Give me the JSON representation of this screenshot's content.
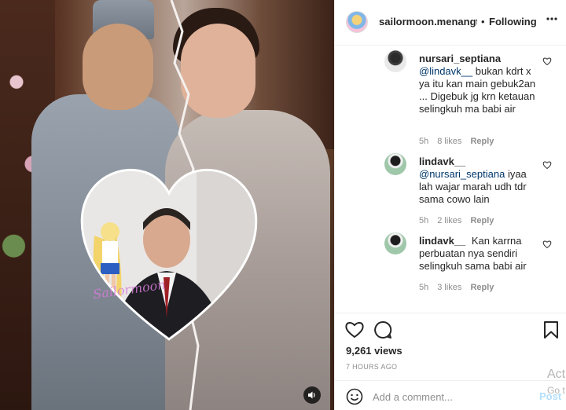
{
  "post": {
    "username": "sailormoon.menangter",
    "separator": "•",
    "follow_status": "Following",
    "watermark": "Sailormoon"
  },
  "comments": [
    {
      "user": "nursari_septiana",
      "mention": "@lindavk__",
      "text": " bukan kdrt x ya itu kan main gebuk2an ... Digebuk jg krn ketauan selingkuh ma babi air",
      "time": "5h",
      "likes": "8 likes",
      "reply": "Reply"
    },
    {
      "user": "lindavk__",
      "mention": "@nursari_septiana",
      "text": " iyaa lah wajar marah udh tdr sama cowo lain",
      "time": "5h",
      "likes": "2 likes",
      "reply": "Reply"
    },
    {
      "user": "lindavk__",
      "mention": "",
      "text": "Kan karrna perbuatan nya sendiri selingkuh sama babi air",
      "time": "5h",
      "likes": "3 likes",
      "reply": "Reply"
    }
  ],
  "stats": {
    "views": "9,261 views",
    "time_ago": "7 HOURS AGO"
  },
  "add_comment": {
    "placeholder": "Add a comment...",
    "post_label": "Post"
  },
  "overlay": {
    "line1": "Act",
    "line2": "Go t"
  },
  "icons": {
    "like": "heart-icon",
    "comment": "comment-icon",
    "save": "bookmark-icon",
    "more": "more-options-icon",
    "emoji": "smiley-icon",
    "sound": "speaker-icon"
  }
}
